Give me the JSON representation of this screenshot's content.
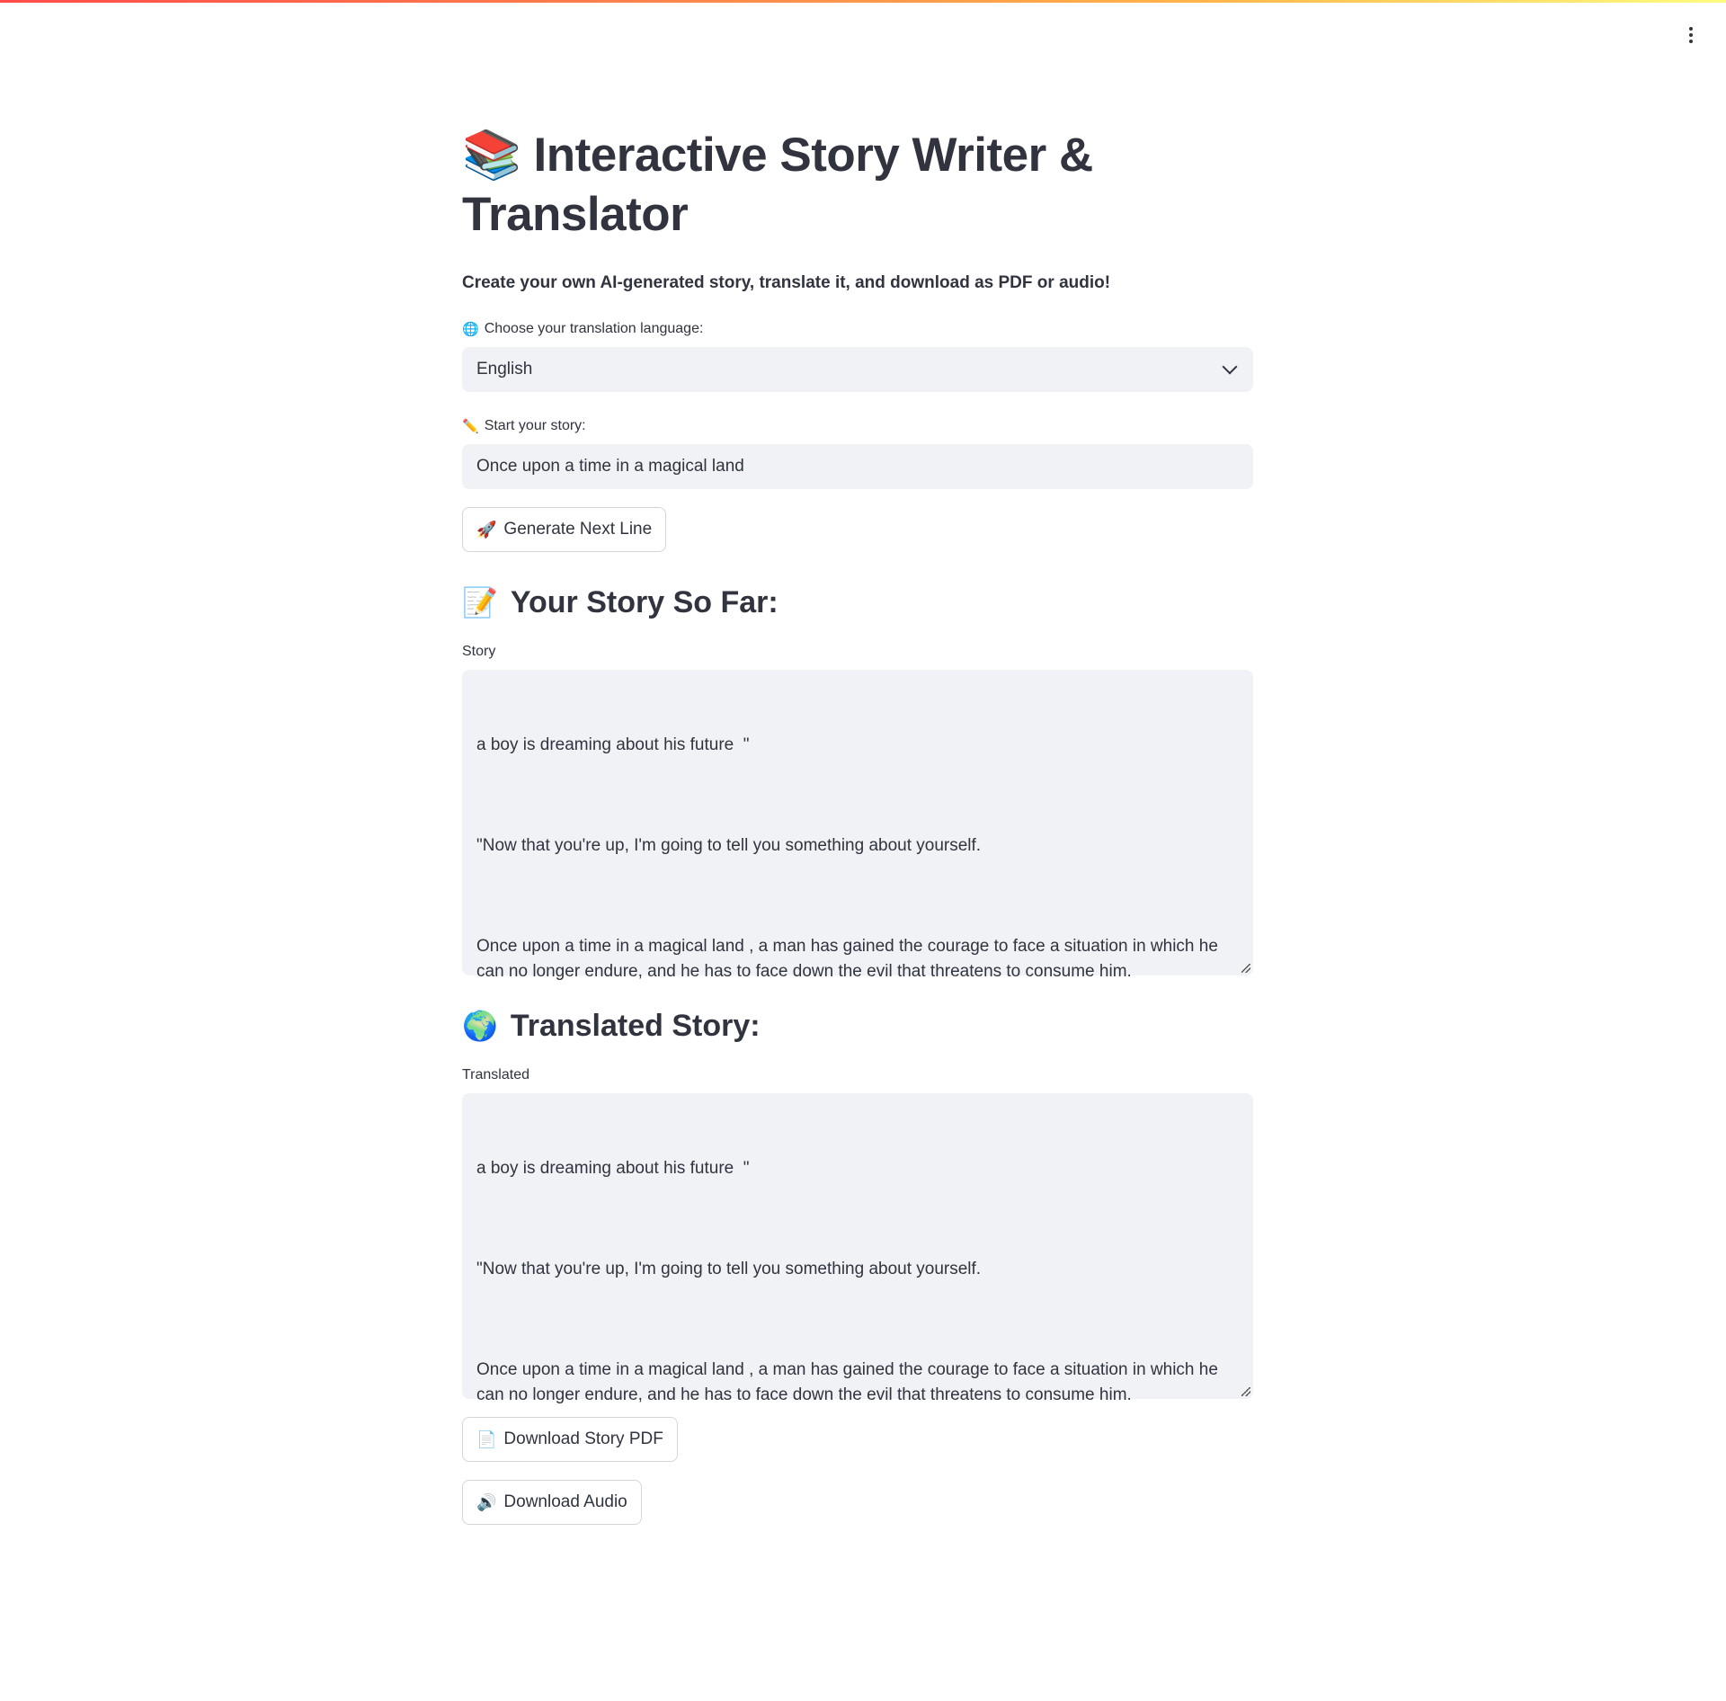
{
  "app": {
    "title_emoji": "📚",
    "title": "Interactive Story Writer & Translator",
    "subtitle": "Create your own AI-generated story, translate it, and download as PDF or audio!"
  },
  "language": {
    "label_icon": "🌐",
    "label": "Choose your translation language:",
    "selected": "English"
  },
  "story_input": {
    "label_icon": "✏️",
    "label": "Start your story:",
    "value": "Once upon a time in a magical land"
  },
  "generate_button": {
    "icon": "🚀",
    "label": "Generate Next Line"
  },
  "story_section": {
    "icon": "📝",
    "heading": "Your Story So Far:",
    "field_label": "Story",
    "paragraphs": [
      "a boy is dreaming about his future  \"",
      "\"Now that you're up, I'm going to tell you something about yourself.",
      "Once upon a time in a magical land , a man has gained the courage to face a situation in which he can no longer endure, and he has to face down the evil that threatens to consume him."
    ]
  },
  "translated_section": {
    "icon": "🌍",
    "heading": "Translated Story:",
    "field_label": "Translated",
    "paragraphs": [
      "a boy is dreaming about his future  \"",
      "\"Now that you're up, I'm going to tell you something about yourself.",
      "Once upon a time in a magical land , a man has gained the courage to face a situation in which he can no longer endure, and he has to face down the evil that threatens to consume him."
    ]
  },
  "download_pdf_button": {
    "icon": "📄",
    "label": "Download Story PDF"
  },
  "download_audio_button": {
    "icon": "🔊",
    "label": "Download Audio"
  },
  "icons": {
    "menu": "kebab-menu-icon"
  }
}
